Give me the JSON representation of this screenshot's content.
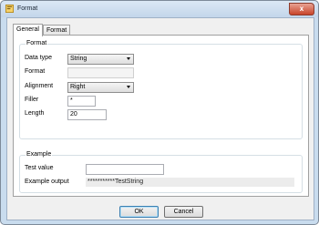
{
  "window": {
    "title": "Format",
    "close_label": "x"
  },
  "tabs": [
    {
      "label": "General"
    },
    {
      "label": "Format"
    }
  ],
  "format_group": {
    "title": "Format",
    "data_type": {
      "label": "Data type",
      "value": "String"
    },
    "format": {
      "label": "Format",
      "value": ""
    },
    "alignment": {
      "label": "Alignment",
      "value": "Right"
    },
    "filler": {
      "label": "Filler",
      "value": "*"
    },
    "length": {
      "label": "Length",
      "value": "20"
    }
  },
  "example_group": {
    "title": "Example",
    "test_value": {
      "label": "Test value",
      "value": ""
    },
    "example_output": {
      "label": "Example output",
      "value": "***********TestString"
    }
  },
  "buttons": {
    "ok": "OK",
    "cancel": "Cancel"
  }
}
